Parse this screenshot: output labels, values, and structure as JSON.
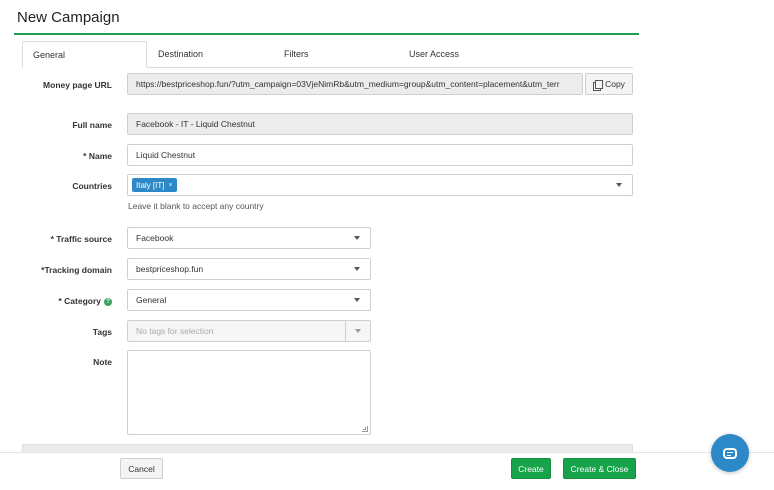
{
  "page": {
    "title": "New Campaign"
  },
  "tabs": [
    "General",
    "Destination",
    "Filters",
    "User Access"
  ],
  "form": {
    "money_page_url": {
      "label": "Money page URL",
      "value": "https://bestpriceshop.fun/?utm_campaign=03VjeNimRb&utm_medium=group&utm_content=placement&utm_terr",
      "copy_label": "Copy"
    },
    "full_name": {
      "label": "Full name",
      "value": "Facebook - IT - Liquid Chestnut"
    },
    "name": {
      "label": "* Name",
      "value": "Liquid Chestnut"
    },
    "countries": {
      "label": "Countries",
      "selected": "Italy [IT]",
      "remove": "×",
      "hint": "Leave it blank to accept any country"
    },
    "traffic_source": {
      "label": "* Traffic source",
      "value": "Facebook"
    },
    "tracking_domain": {
      "label": "*Tracking domain",
      "value": "bestpriceshop.fun"
    },
    "category": {
      "label": "* Category",
      "value": "General",
      "help": "?"
    },
    "tags": {
      "label": "Tags",
      "placeholder": "No tags for selection"
    },
    "note": {
      "label": "Note",
      "value": ""
    }
  },
  "footer": {
    "cancel": "Cancel",
    "create": "Create",
    "create_close": "Create & Close"
  },
  "colors": {
    "accent_green": "#16a34a",
    "chip_blue": "#2d88c7",
    "title_rule": "#1f9d55"
  },
  "icons": [
    "copy-icon",
    "chevron-down-icon",
    "help-icon",
    "chat-icon",
    "resize-handle-icon"
  ]
}
